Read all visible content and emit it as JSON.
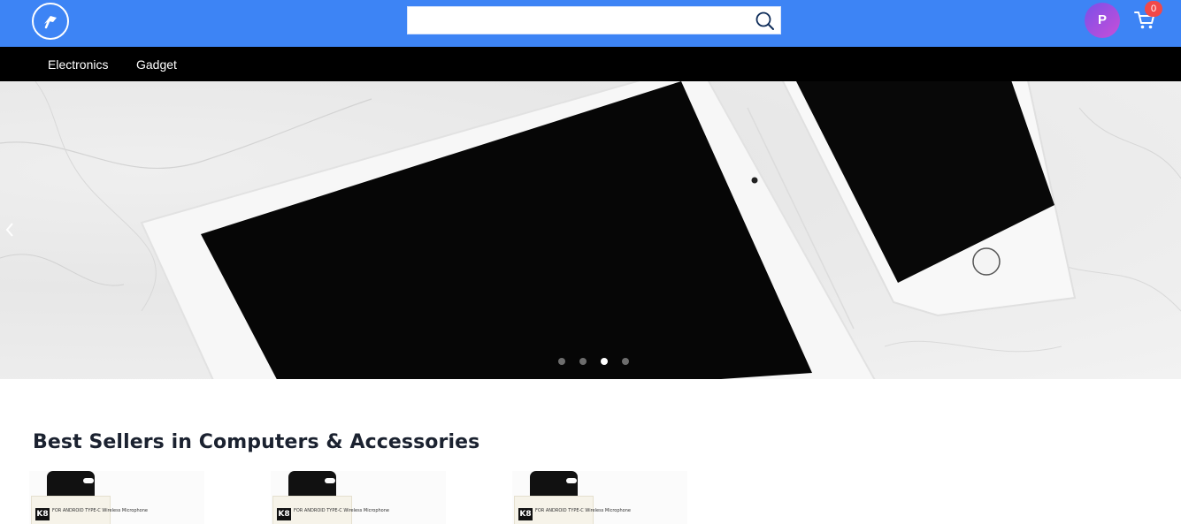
{
  "header": {
    "search": {
      "value": "",
      "placeholder": ""
    },
    "avatar_initial": "P",
    "cart_count": "0",
    "icons": {
      "logo": "brand-logo-icon",
      "search": "search-icon",
      "cart": "cart-icon"
    }
  },
  "nav": {
    "categories": [
      {
        "label": "Electronics"
      },
      {
        "label": "Gadget"
      }
    ]
  },
  "carousel": {
    "slide_count": 4,
    "active_slide": 3
  },
  "best_sellers": {
    "title": "Best Sellers in Computers & Accessories",
    "products": [
      {
        "tag": "K8",
        "caption": "FOR ANDROID TYPE-C\nWireless Microphone"
      },
      {
        "tag": "K8",
        "caption": "FOR ANDROID TYPE-C\nWireless Microphone"
      },
      {
        "tag": "K8",
        "caption": "FOR ANDROID TYPE-C\nWireless Microphone"
      }
    ]
  },
  "colors": {
    "header_bg": "#3d84f5",
    "nav_bg": "#000000",
    "badge": "#f24848",
    "title_text": "#1b2230"
  }
}
